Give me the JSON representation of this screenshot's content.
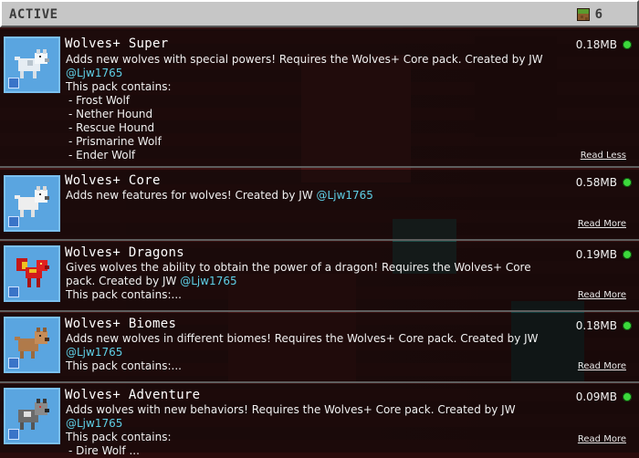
{
  "header": {
    "title": "ACTIVE",
    "pack_count": "6"
  },
  "colors": {
    "accent_handle": "#5ecfe6",
    "status_active": "#3cd93c",
    "header_bg": "#c6c6c6"
  },
  "packs": [
    {
      "title": "Wolves+ Super",
      "description": "Adds new wolves with special powers! Requires the Wolves+ Core pack. Created by JW",
      "handle": "@Ljw1765",
      "contents_heading": "This pack contains:",
      "contents": [
        "- Frost Wolf",
        "- Nether Hound",
        "- Rescue Hound",
        "- Prismarine Wolf",
        "- Ender Wolf"
      ],
      "size": "0.18MB",
      "link": "Read Less",
      "icon": "frost-wolf-icon"
    },
    {
      "title": "Wolves+ Core",
      "description": "Adds new features for wolves! Created by JW",
      "handle": "@Ljw1765",
      "size": "0.58MB",
      "link": "Read More",
      "icon": "white-wolf-icon"
    },
    {
      "title": "Wolves+ Dragons",
      "description": "Gives wolves the ability to obtain the power of a dragon! Requires the Wolves+ Core pack. Created by JW",
      "handle": "@Ljw1765",
      "contents_heading": "This pack contains:...",
      "size": "0.19MB",
      "link": "Read More",
      "icon": "red-dragon-wolf-icon"
    },
    {
      "title": "Wolves+ Biomes",
      "description": "Adds new wolves in different biomes! Requires the Wolves+ Core pack. Created by JW",
      "handle": "@Ljw1765",
      "contents_heading": "This pack contains:...",
      "size": "0.18MB",
      "link": "Read More",
      "icon": "brown-wolf-icon"
    },
    {
      "title": "Wolves+ Adventure",
      "description": "Adds wolves with new behaviors! Requires the Wolves+ Core pack. Created by JW",
      "handle": "@Ljw1765",
      "contents_heading": "This pack contains:",
      "contents": [
        "- Dire Wolf ..."
      ],
      "size": "0.09MB",
      "link": "Read More",
      "icon": "dire-wolf-icon"
    }
  ]
}
